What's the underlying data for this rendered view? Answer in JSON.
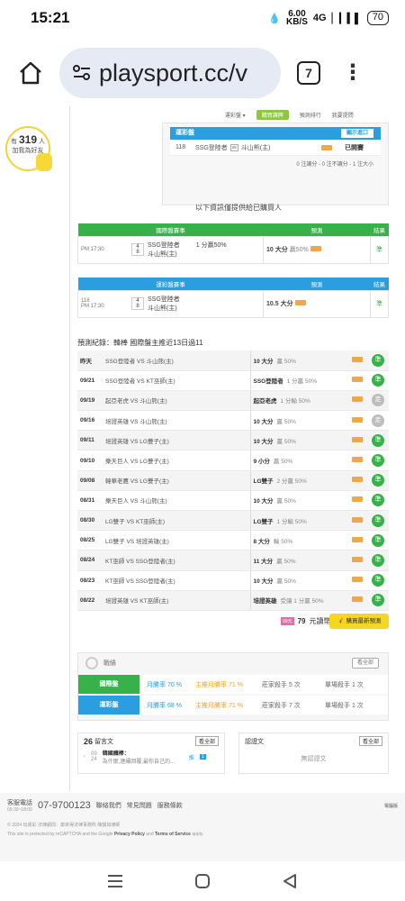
{
  "status": {
    "time": "15:21",
    "speed_value": "6.00",
    "speed_unit": "KB/S",
    "network": "4G",
    "battery": "70"
  },
  "browser": {
    "url": "playsport.cc/v",
    "tab_count": "7"
  },
  "side": {
    "prefix": "有",
    "count": "319",
    "suffix": "人",
    "line2": "加我為好友"
  },
  "topnav": {
    "items": [
      "運彩盤 ▾",
      "購買讀牌",
      "預測排行",
      "我要提問"
    ]
  },
  "pick_box": {
    "header": "運彩盤",
    "show_button": "顯示進口",
    "code": "118",
    "team1": "SSG登陸者",
    "vs": "vs",
    "team2": "斗山熊(主)",
    "status": "已開賽",
    "note": "0 注讓分 - 0 注不讓分 - 1 注大小"
  },
  "info_line": "以下資訊僅提供給已購買人",
  "intl_table": {
    "headers": [
      "國際盤賽事",
      "預測",
      "結果"
    ],
    "time": "PM 17:30",
    "num1": "4",
    "num2": "8",
    "team1": "SSG登陸者",
    "team2": "斗山熊(主)",
    "handicap": "1 分贏50%",
    "pick": "10 大分",
    "pick_note": "贏50%",
    "result": "準"
  },
  "sport_table": {
    "headers": [
      "運彩盤賽事",
      "預測",
      "結果"
    ],
    "code": "118",
    "time": "PM 17:30",
    "num1": "4",
    "num2": "8",
    "team1": "SSG登陸者",
    "team2": "斗山熊(主)",
    "pick": "10.5 大分",
    "result": "準"
  },
  "record_title": "預測紀錄：韓棒 國際盤主推近13日過11",
  "records": [
    {
      "date": "昨天",
      "match": "SSG登陸者 VS 斗山熊(主)",
      "pick": "10 大分",
      "note": "贏 50%",
      "res": "準"
    },
    {
      "date": "09/21",
      "match": "SSG登陸者 VS KT巫師(主)",
      "pick": "SSG登陸者",
      "note": "1 分贏 50%",
      "res": "準"
    },
    {
      "date": "09/19",
      "match": "起亞老虎 VS 斗山熊(主)",
      "pick": "起亞老虎",
      "note": "1 分輸 50%",
      "res": "走"
    },
    {
      "date": "09/16",
      "match": "培證英雄 VS 斗山熊(主)",
      "pick": "10 大分",
      "note": "贏 50%",
      "res": "走"
    },
    {
      "date": "09/11",
      "match": "培證英雄 VS LG雙子(主)",
      "pick": "10 大分",
      "note": "贏 50%",
      "res": "準"
    },
    {
      "date": "09/10",
      "match": "樂天巨人 VS LG雙子(主)",
      "pick": "9 小分",
      "note": "贏 50%",
      "res": "準"
    },
    {
      "date": "09/08",
      "match": "韓華老鷹 VS LG雙子(主)",
      "pick": "LG雙子",
      "note": "2 分贏 50%",
      "res": "準"
    },
    {
      "date": "08/31",
      "match": "樂天巨人 VS 斗山熊(主)",
      "pick": "10 大分",
      "note": "贏 50%",
      "res": "準"
    },
    {
      "date": "08/30",
      "match": "LG雙子 VS KT巫師(主)",
      "pick": "LG雙子",
      "note": "1 分輸 50%",
      "res": "準"
    },
    {
      "date": "08/25",
      "match": "LG雙子 VS 培證英雄(主)",
      "pick": "8 大分",
      "note": "輸 50%",
      "res": "準"
    },
    {
      "date": "08/24",
      "match": "KT巫師 VS SSG登陸者(主)",
      "pick": "11 大分",
      "note": "贏 50%",
      "res": "準"
    },
    {
      "date": "08/23",
      "match": "KT巫師 VS SSG登陸者(主)",
      "pick": "10 大分",
      "note": "贏 50%",
      "res": "準"
    },
    {
      "date": "08/22",
      "match": "培證英雄 VS KT巫師(主)",
      "pick": "培證英雄",
      "note": "受讓 1 分贏 50%",
      "res": "準"
    }
  ],
  "price": {
    "badge": "99元",
    "amount": "79",
    "unit": "元讀幣",
    "buy": "購買最新預測"
  },
  "stats": {
    "title": "戰績",
    "viewall": "看全部",
    "rows": [
      {
        "label": "國際盤",
        "c1": "月勝率 70",
        "c1u": "%",
        "c2": "主推月勝率 71",
        "c2u": "%",
        "c3": "莊家殺手 5",
        "c3u": "次",
        "c4": "單場殺手 1",
        "c4u": "次"
      },
      {
        "label": "運彩盤",
        "c1": "月勝率 68",
        "c1u": "%",
        "c2": "主推月勝率 71",
        "c2u": "%",
        "c3": "莊家殺手 7",
        "c3u": "次",
        "c4": "單場殺手 1",
        "c4u": "次"
      }
    ]
  },
  "msg_left": {
    "count": "26",
    "label": "留言文",
    "viewall": "看全部",
    "date1": "09",
    "date2": "24",
    "title": "韓國癮棒：",
    "body": "為什麼,連續回覆,最你自己的...",
    "tag": "推",
    "num": "1"
  },
  "msg_right": {
    "label": "認證文",
    "viewall": "看全部",
    "empty": "無認證文"
  },
  "footer": {
    "service_label": "客服電話",
    "hours": "09:30~18:00",
    "phone": "07-9700123",
    "links": [
      "聯絡我們",
      "常見問題",
      "服務條款"
    ],
    "right": "電腦版",
    "copyright": "© 2024 玩運彩 法律顧問：康來得法律事務所 陳韻如律師",
    "recaptcha_pre": "This site is protected by reCAPTCHA and the Google ",
    "privacy": "Privacy Policy",
    "and": " and ",
    "terms": "Terms of Service",
    "apply": " apply."
  }
}
